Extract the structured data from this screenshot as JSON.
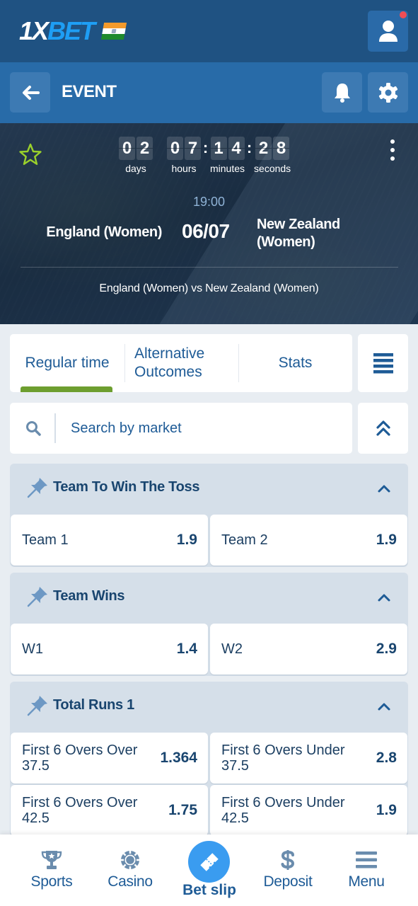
{
  "header": {
    "logo": {
      "part1": "1X",
      "part2": "BET"
    },
    "flag": "india-flag",
    "profile_icon": "user-icon",
    "notification_dot": true
  },
  "subheader": {
    "back_icon": "arrow-left-icon",
    "title": "EVENT",
    "bell_icon": "bell-icon",
    "settings_icon": "gear-icon"
  },
  "event": {
    "favorite_icon": "star-outline-icon",
    "more_icon": "kebab-menu-icon",
    "countdown": {
      "days": [
        "0",
        "2"
      ],
      "hours": [
        "0",
        "7"
      ],
      "minutes": [
        "1",
        "4"
      ],
      "seconds": [
        "2",
        "8"
      ],
      "separator": ":",
      "labels": {
        "days": "days",
        "hours": "hours",
        "minutes": "minutes",
        "seconds": "seconds"
      }
    },
    "time": "19:00",
    "date": "06/07",
    "team1": "England (Women)",
    "team2": "New Zealand (Women)",
    "match_name": "England (Women) vs New Zealand (Women)"
  },
  "tabs": {
    "items": [
      {
        "label": "Regular time",
        "active": true
      },
      {
        "label": "Alternative Outcomes",
        "active": false
      },
      {
        "label": "Stats",
        "active": false
      }
    ],
    "menu_icon": "list-menu-icon"
  },
  "search": {
    "placeholder": "Search by market",
    "value": "",
    "collapse_icon": "double-chevron-up-icon"
  },
  "markets": [
    {
      "title": "Team To Win The Toss",
      "pinned": true,
      "expanded": true,
      "outcomes": [
        {
          "label": "Team 1",
          "odds": "1.9"
        },
        {
          "label": "Team 2",
          "odds": "1.9"
        }
      ]
    },
    {
      "title": "Team Wins",
      "pinned": true,
      "expanded": true,
      "outcomes": [
        {
          "label": "W1",
          "odds": "1.4"
        },
        {
          "label": "W2",
          "odds": "2.9"
        }
      ]
    },
    {
      "title": "Total Runs 1",
      "pinned": true,
      "expanded": true,
      "outcomes": [
        {
          "label": "First 6 Overs Over 37.5",
          "odds": "1.364"
        },
        {
          "label": "First 6 Overs Under 37.5",
          "odds": "2.8"
        },
        {
          "label": "First 6 Overs Over 42.5",
          "odds": "1.75"
        },
        {
          "label": "First 6 Overs Under 42.5",
          "odds": "1.9"
        }
      ]
    }
  ],
  "bottom_nav": {
    "items": [
      {
        "label": "Sports",
        "icon": "trophy-icon"
      },
      {
        "label": "Casino",
        "icon": "casino-chip-icon"
      },
      {
        "label": "Bet slip",
        "icon": "ticket-icon",
        "active": true
      },
      {
        "label": "Deposit",
        "icon": "dollar-icon"
      },
      {
        "label": "Menu",
        "icon": "hamburger-icon"
      }
    ]
  },
  "colors": {
    "header_bg": "#1f5282",
    "subheader_bg": "#286ba8",
    "accent_blue": "#3a9cf0",
    "active_tab_underline": "#6d9e2f",
    "favorite_star": "#9ad12b",
    "notification": "#f04d55",
    "text_primary": "#1e5b96"
  }
}
